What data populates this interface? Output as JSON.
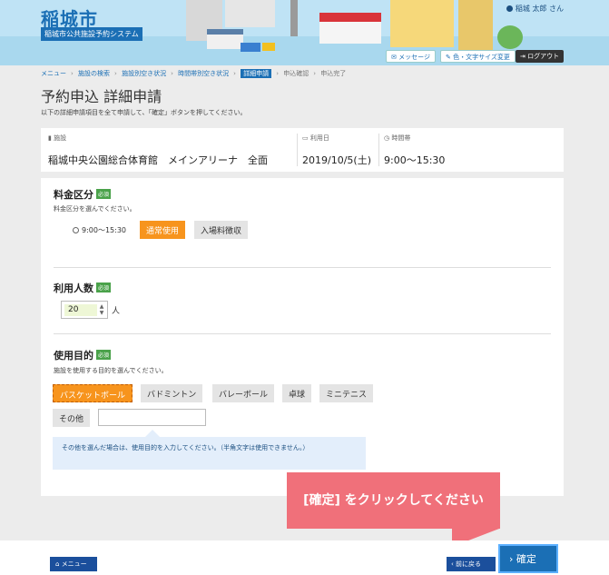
{
  "header": {
    "city": "稲城市",
    "system_name": "稲城市公共施設予約システム",
    "user": "稲城 太郎 さん",
    "message_btn": "メッセージ",
    "font_btn": "色・文字サイズ変更",
    "logout_btn": "ログアウト"
  },
  "breadcrumb": [
    "メニュー",
    "施設の検索",
    "施設別空き状況",
    "時間帯別空き状況",
    "詳細申請",
    "申込確認",
    "申込完了"
  ],
  "page": {
    "title": "予約申込 詳細申請",
    "description": "以下の詳細申請項目を全て申請して、「確定」ボタンを押してください。"
  },
  "info": {
    "facility_label": "施設",
    "facility": "稲城中央公園総合体育館　メインアリーナ　全面",
    "date_label": "利用日",
    "date": "2019/10/5(土)",
    "time_label": "時間帯",
    "time": "9:00〜15:30"
  },
  "fee": {
    "title": "料金区分",
    "required": "必須",
    "desc": "料金区分を選んでください。",
    "time": "9:00〜15:30",
    "options": [
      "通常使用",
      "入場料徴収"
    ]
  },
  "people": {
    "title": "利用人数",
    "required": "必須",
    "value": "20",
    "unit": "人"
  },
  "purpose": {
    "title": "使用目的",
    "required": "必須",
    "desc": "施設を使用する目的を選んでください。",
    "options": [
      "バスケットボール",
      "バドミントン",
      "バレーボール",
      "卓球",
      "ミニテニス",
      "その他"
    ],
    "hint": "その他を選んだ場合は、使用目的を入力してください。（半角文字は使用できません。）"
  },
  "footer": {
    "menu": "メニュー",
    "back": "前に戻る",
    "confirm": "確定"
  },
  "callout": "[確定] をクリックしてください"
}
